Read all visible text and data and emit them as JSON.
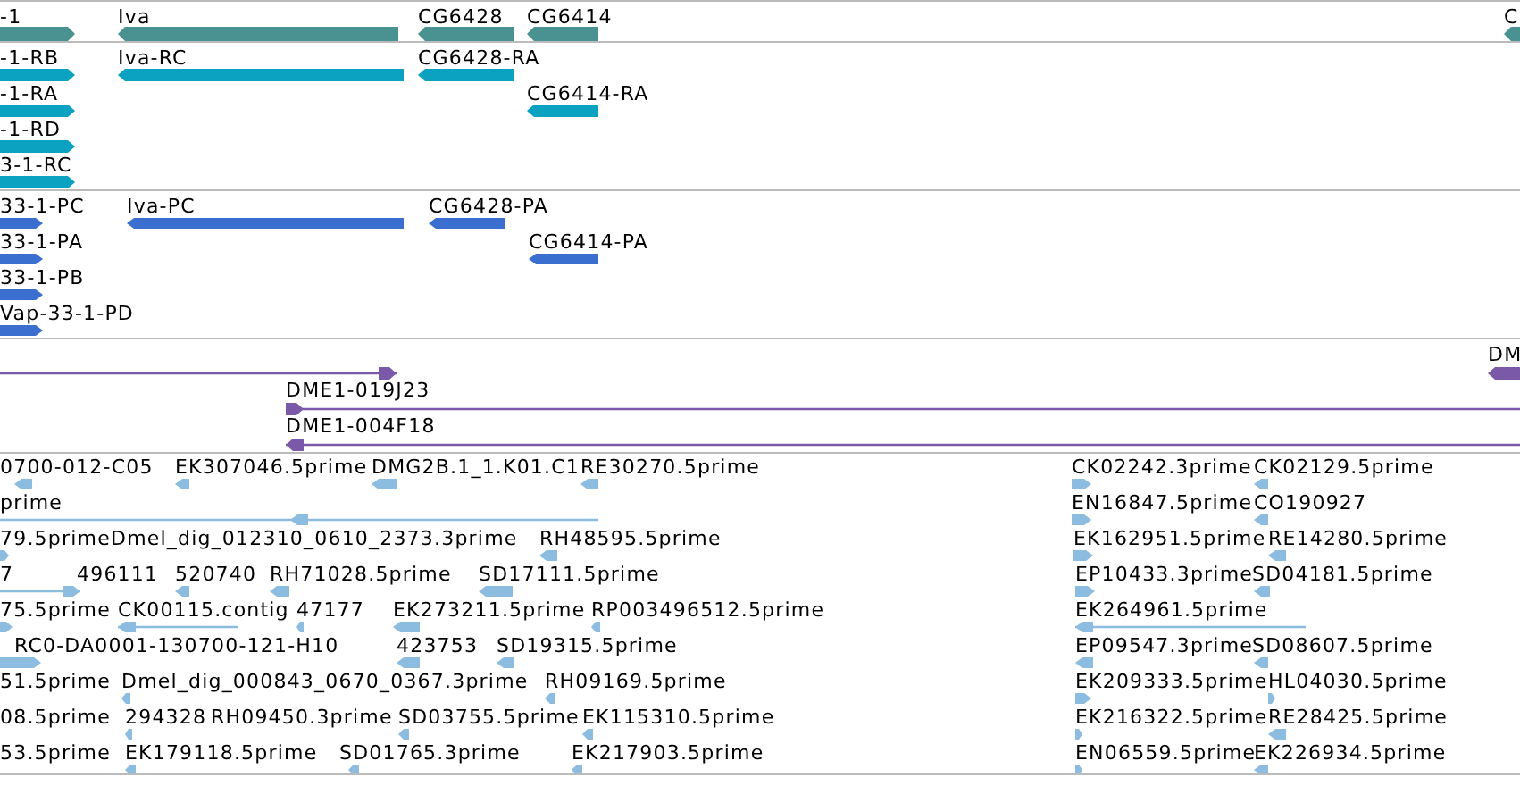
{
  "tracks": [
    {
      "kind": "gene",
      "features": [
        {
          "label": "-1",
          "reverse": false
        },
        {
          "label": "Iva",
          "reverse": true
        },
        {
          "label": "CG6428",
          "reverse": true
        },
        {
          "label": "CG6414",
          "reverse": true
        },
        {
          "label": "C",
          "reverse": true
        }
      ]
    },
    {
      "kind": "transcript",
      "features": [
        {
          "label": "-1-RB",
          "reverse": false
        },
        {
          "label": "Iva-RC",
          "reverse": true
        },
        {
          "label": "CG6428-RA",
          "reverse": true
        },
        {
          "label": "-1-RA",
          "reverse": false
        },
        {
          "label": "CG6414-RA",
          "reverse": true
        },
        {
          "label": "-1-RD",
          "reverse": false
        },
        {
          "label": "3-1-RC",
          "reverse": false
        }
      ]
    },
    {
      "kind": "protein",
      "features": [
        {
          "label": "33-1-PC",
          "reverse": false
        },
        {
          "label": "Iva-PC",
          "reverse": true
        },
        {
          "label": "CG6428-PA",
          "reverse": true
        },
        {
          "label": "33-1-PA",
          "reverse": false
        },
        {
          "label": "CG6414-PA",
          "reverse": true
        },
        {
          "label": "33-1-PB",
          "reverse": false
        },
        {
          "label": "Vap-33-1-PD",
          "reverse": false
        }
      ]
    },
    {
      "kind": "clone",
      "features": [
        {
          "reverse": false
        },
        {
          "label": "DM",
          "reverse": true
        },
        {
          "label": "DME1-019J23",
          "reverse": false
        },
        {
          "label": "DME1-004F18",
          "reverse": true
        }
      ]
    },
    {
      "kind": "est",
      "features": [
        {
          "label": "0700-012-C05",
          "reverse": true
        },
        {
          "label": "EK307046.5prime",
          "reverse": true
        },
        {
          "label": "DMG2B.1_1.K01.C1",
          "reverse": true
        },
        {
          "label": "RE30270.5prime",
          "reverse": true
        },
        {
          "label": "CK02242.3prime",
          "reverse": false
        },
        {
          "label": "CK02129.5prime",
          "reverse": true
        },
        {
          "label": "prime",
          "reverse": true
        },
        {
          "label": "EN16847.5prime",
          "reverse": false
        },
        {
          "label": "CO190927",
          "reverse": true
        },
        {
          "label": "79.5prime",
          "reverse": false
        },
        {
          "label": "Dmel_dig_012310_0610_2373.3prime"
        },
        {
          "label": "RH48595.5prime",
          "reverse": true
        },
        {
          "label": "EK162951.5prime",
          "reverse": false
        },
        {
          "label": "RE14280.5prime",
          "reverse": true
        },
        {
          "label": "7",
          "reverse": false
        },
        {
          "label": "496111"
        },
        {
          "label": "520740",
          "reverse": true
        },
        {
          "label": "RH71028.5prime",
          "reverse": true
        },
        {
          "label": "SD17111.5prime",
          "reverse": true
        },
        {
          "label": "EP10433.3prime",
          "reverse": false
        },
        {
          "label": "SD04181.5prime",
          "reverse": true
        },
        {
          "label": "75.5prime",
          "reverse": false
        },
        {
          "label": "CK00115.contig",
          "reverse": true
        },
        {
          "label": "47177",
          "reverse": true
        },
        {
          "label": "EK273211.5prime",
          "reverse": true
        },
        {
          "label": "RP003496512.5prime",
          "reverse": true
        },
        {
          "label": "EK264961.5prime",
          "reverse": true
        },
        {
          "label": "RC0-DA0001-130700-121-H10",
          "reverse": false
        },
        {
          "label": "423753",
          "reverse": true
        },
        {
          "label": "SD19315.5prime",
          "reverse": true
        },
        {
          "label": "EP09547.3prime",
          "reverse": true
        },
        {
          "label": "SD08607.5prime",
          "reverse": true
        },
        {
          "label": "51.5prime"
        },
        {
          "label": "Dmel_dig_000843_0670_0367.3prime",
          "reverse": true
        },
        {
          "label": "RH09169.5prime",
          "reverse": true
        },
        {
          "label": "EK209333.5prime",
          "reverse": false
        },
        {
          "label": "HL04030.5prime",
          "reverse": false
        },
        {
          "label": "08.5prime"
        },
        {
          "label": "294328",
          "reverse": true
        },
        {
          "label": "RH09450.3prime"
        },
        {
          "label": "SD03755.5prime",
          "reverse": true
        },
        {
          "label": "EK115310.5prime",
          "reverse": true
        },
        {
          "label": "EK216322.5prime",
          "reverse": false
        },
        {
          "label": "RE28425.5prime",
          "reverse": true
        },
        {
          "label": "53.5prime"
        },
        {
          "label": "EK179118.5prime",
          "reverse": true
        },
        {
          "label": "SD01765.3prime",
          "reverse": true
        },
        {
          "label": "EK217903.5prime",
          "reverse": true
        },
        {
          "label": "EN06559.5prime",
          "reverse": false
        },
        {
          "label": "EK226934.5prime",
          "reverse": true
        }
      ]
    }
  ]
}
